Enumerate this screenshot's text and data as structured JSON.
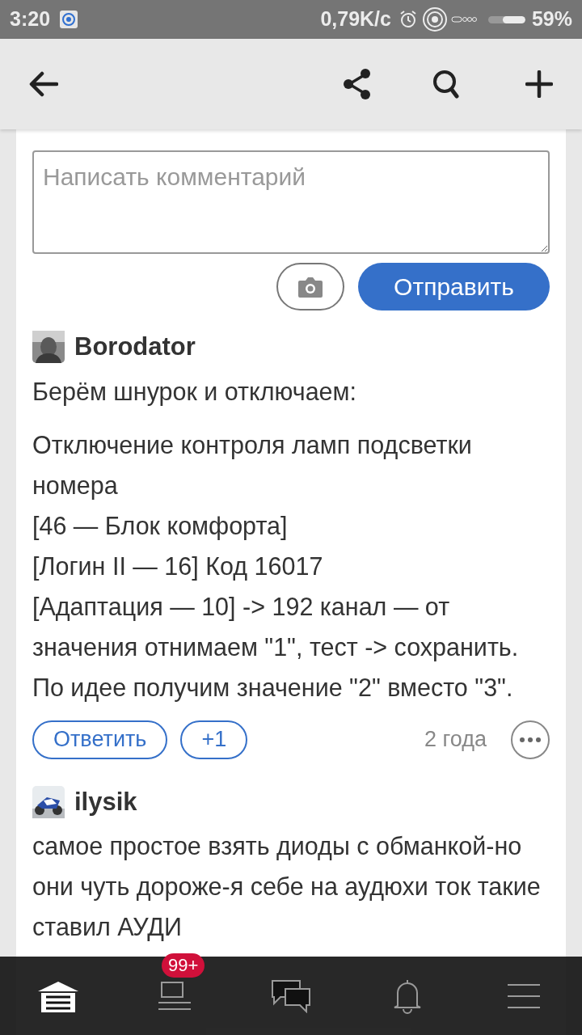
{
  "status_bar": {
    "time": "3:20",
    "speed": "0,79K/c",
    "battery_text": "59%"
  },
  "comment_form": {
    "placeholder": "Написать комментарий",
    "submit": "Отправить"
  },
  "comments": [
    {
      "author": "Borodator",
      "paragraphs": [
        [
          "Берём шнурок и отключаем:"
        ],
        [
          "Отключение контроля ламп подсветки номера",
          "[46 — Блок комфорта]",
          "[Логин II — 16] Код 16017",
          "[Адаптация — 10] -> 192 канал — от значения отнимаем \"1\", тест -> сохранить.",
          "По идее получим значение \"2\" вместо \"3\"."
        ]
      ],
      "reply": "Ответить",
      "plus": "+1",
      "age": "2 года"
    },
    {
      "author": "ilysik",
      "paragraphs": [
        [
          "самое простое взять диоды с обманкой-но они чуть дороже-я себе на аудюхи ток такие ставил АУДИ"
        ]
      ]
    }
  ],
  "bottom_nav": [
    {
      "kind": "garage",
      "selected": true
    },
    {
      "kind": "feed",
      "selected": false,
      "badge": "99+"
    },
    {
      "kind": "chats",
      "selected": false
    },
    {
      "kind": "bell",
      "selected": false
    },
    {
      "kind": "menu",
      "selected": false
    }
  ]
}
